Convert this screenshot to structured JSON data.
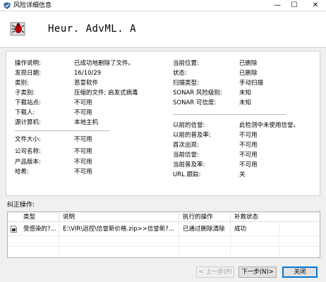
{
  "window": {
    "title": "风险详细信息",
    "minimize_glyph": "—",
    "maximize_glyph": "☐",
    "close_glyph": "✕"
  },
  "header": {
    "threat_name": "Heur. AdvML. A",
    "icon": "bug-icon"
  },
  "details": {
    "left": [
      {
        "label": "操作说明:",
        "value": "已成功地删除了文件。"
      },
      {
        "label": "发现日期:",
        "value": "16/10/29"
      },
      {
        "label": "类别:",
        "value": "恶意软件"
      },
      {
        "label": "子类别:",
        "value": "压缩的文件; 启发式病毒"
      },
      {
        "label": "下载站点:",
        "value": "不可用"
      },
      {
        "label": "下载人:",
        "value": "不可用"
      },
      {
        "label": "源计算机:",
        "value": "本地主机"
      }
    ],
    "left_lower": [
      {
        "label": "文件大小:",
        "value": "不可用"
      },
      {
        "label": "公司名称:",
        "value": "不可用"
      },
      {
        "label": "产品版本:",
        "value": "不可用"
      },
      {
        "label": "哈希:",
        "value": "不可用"
      }
    ],
    "right": [
      {
        "label": "当前位置:",
        "value": "已删除"
      },
      {
        "label": "状态:",
        "value": "已删除"
      },
      {
        "label": "扫描类型:",
        "value": "手动扫描"
      },
      {
        "label": "SONAR 风险级别:",
        "value": "未知"
      },
      {
        "label": "SONAR 可信度:",
        "value": "未知"
      }
    ],
    "right_lower": [
      {
        "label": "以前的信誉:",
        "value": "此检测中未使用信誉。"
      },
      {
        "label": "以前的普及率:",
        "value": "不可用"
      },
      {
        "label": "首次出现:",
        "value": "不可用"
      },
      {
        "label": "当前信誉:",
        "value": "不可用"
      },
      {
        "label": "当前普及率:",
        "value": "不可用"
      },
      {
        "label": "URL 跟踪:",
        "value": "关"
      }
    ]
  },
  "actions": {
    "label": "纠正操作:",
    "columns": [
      "类型",
      "说明",
      "执行的操作",
      "补救状态"
    ],
    "rows": [
      {
        "type": "受感染的?...",
        "description": "E:\\VIR\\远控\\信誉新价格.zip>>信誉新?...",
        "action": "已通过删除清除",
        "status": "成功"
      }
    ]
  },
  "buttons": {
    "prev": "< 上一步(P)",
    "next": "下一步(N)>",
    "close": "关闭"
  }
}
